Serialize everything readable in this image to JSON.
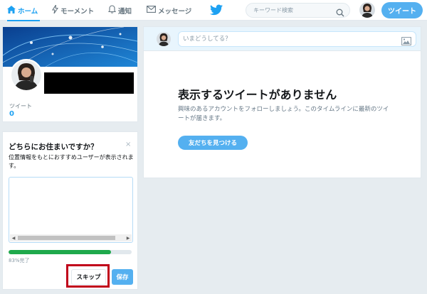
{
  "nav": {
    "home": "ホーム",
    "moments": "モーメント",
    "notifications": "通知",
    "messages": "メッセージ"
  },
  "search": {
    "placeholder": "キーワード検索"
  },
  "tweet_button": "ツイート",
  "profile": {
    "tweets_label": "ツイート",
    "tweets_count": "0"
  },
  "location_card": {
    "title": "どちらにお住まいですか？",
    "close": "×",
    "description": "位置情報をもとにおすすめユーザーが表示されます。",
    "progress_fraction": 0.83,
    "progress_text": "83%完了",
    "skip": "スキップ",
    "save": "保存"
  },
  "compose": {
    "placeholder": "いまどうしてる？"
  },
  "timeline": {
    "empty_title": "表示するツイートがありません",
    "empty_description": "興味のあるアカウントをフォローしましょう。このタイムラインに最新のツイートが届きます。",
    "find_friends": "友だちを見つける"
  },
  "colors": {
    "accent": "#1da1f2",
    "button": "#54b0f0",
    "progress": "#1fa94c",
    "highlight": "#c0001a"
  }
}
